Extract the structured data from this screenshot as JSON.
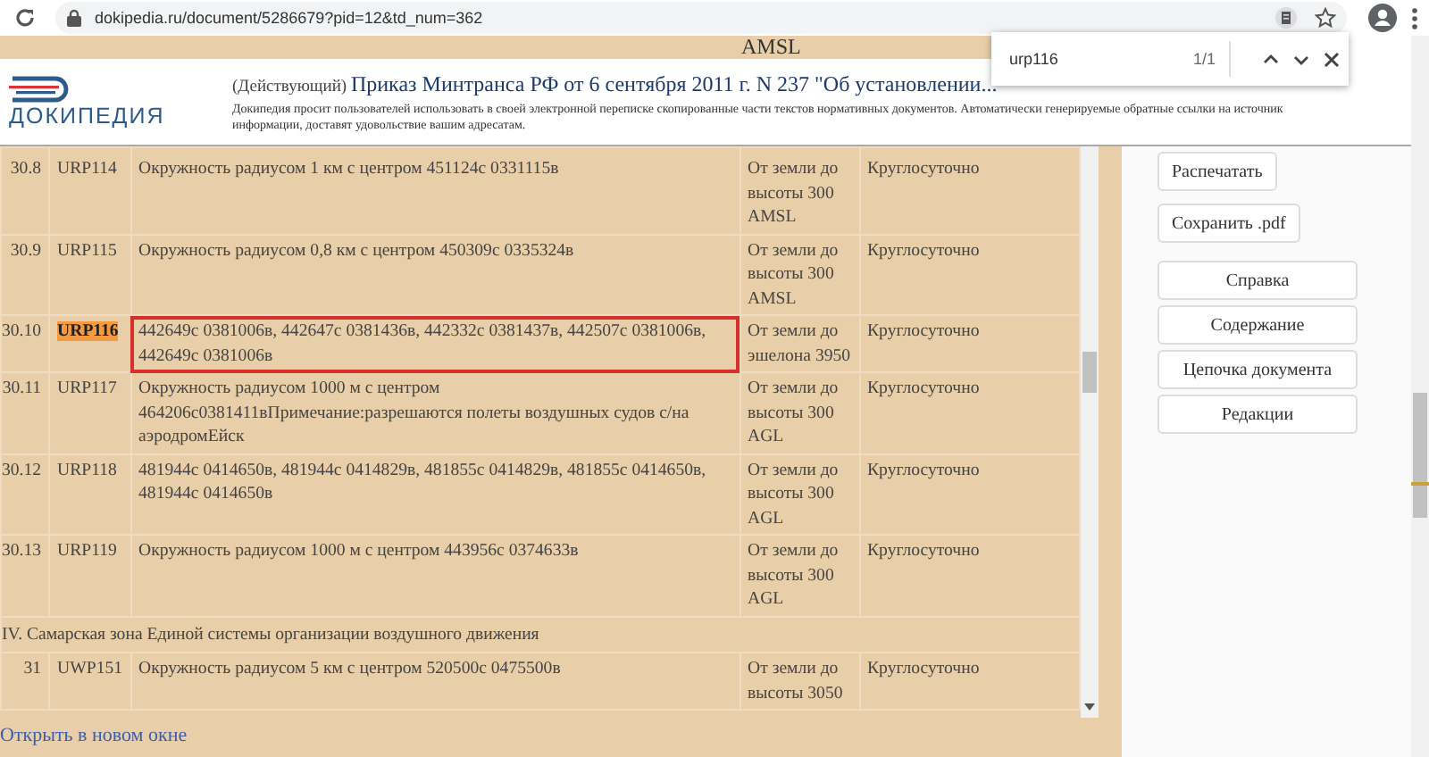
{
  "browser": {
    "url": "dokipedia.ru/document/5286679?pid=12&td_num=362",
    "find_bar": {
      "query": "urp116",
      "count": "1/1"
    }
  },
  "cut_row": {
    "altitude": "AMSL"
  },
  "header": {
    "logo_text": "ДОКИПЕДИЯ",
    "status": "(Действующий)",
    "title": "Приказ Минтранса РФ от 6 сентября 2011 г. N 237 \"Об установлении...",
    "notice": "Докипедия просит пользователей использовать в своей электронной переписке скопированные части текстов нормативных документов. Автоматически генерируемые обратные ссылки на источник информации, доставят удовольствие вашим адресатам."
  },
  "table": {
    "rows": [
      {
        "kind": "row",
        "number": "30.8",
        "code": "URP114",
        "description": "Окружность радиусом 1 км с центром 451124с 0331115в",
        "altitude": "От земли до высоты 300 AMSL",
        "schedule": "Круглосуточно",
        "search_match": false,
        "outlined": false
      },
      {
        "kind": "row",
        "number": "30.9",
        "code": "URP115",
        "description": "Окружность радиусом 0,8 км с центром 450309с 0335324в",
        "altitude": "От земли до высоты 300 AMSL",
        "schedule": "Круглосуточно",
        "search_match": false,
        "outlined": false
      },
      {
        "kind": "row",
        "number": "30.10",
        "code": "URP116",
        "description": "442649с 0381006в, 442647с 0381436в, 442332с 0381437в, 442507с 0381006в, 442649с 0381006в",
        "altitude": "От земли до эшелона 3950",
        "schedule": "Круглосуточно",
        "search_match": true,
        "outlined": true
      },
      {
        "kind": "row",
        "number": "30.11",
        "code": "URP117",
        "description": "Окружность радиусом 1000 м с центром 464206с0381411вПримечание:разрешаются полеты воздушных судов с/на аэродромЕйск",
        "altitude": "От земли до высоты 300 AGL",
        "schedule": "Круглосуточно",
        "search_match": false,
        "outlined": false
      },
      {
        "kind": "row",
        "number": "30.12",
        "code": "URP118",
        "description": "481944с 0414650в, 481944с 0414829в, 481855с 0414829в, 481855с 0414650в, 481944с 0414650в",
        "altitude": "От земли до высоты 300 AGL",
        "schedule": "Круглосуточно",
        "search_match": false,
        "outlined": false
      },
      {
        "kind": "row",
        "number": "30.13",
        "code": "URP119",
        "description": "Окружность радиусом 1000 м с центром 443956с 0374633в",
        "altitude": "От земли до высоты 300 AGL",
        "schedule": "Круглосуточно",
        "search_match": false,
        "outlined": false
      },
      {
        "kind": "section",
        "title": "IV. Самарская зона Единой системы организации воздушного движения"
      },
      {
        "kind": "row",
        "number": "31",
        "code": "UWP151",
        "description": "Окружность радиусом 5 км с центром 520500с 0475500в",
        "altitude": "От земли до высоты 3050",
        "schedule": "Круглосуточно",
        "search_match": false,
        "outlined": false
      }
    ]
  },
  "open_link": "Открыть в новом окне",
  "buttons": [
    {
      "label": "Распечатать",
      "kind": "small"
    },
    {
      "label": "Сохранить .pdf",
      "kind": "small"
    },
    {
      "label": "Справка",
      "kind": "wide"
    },
    {
      "label": "Содержание",
      "kind": "wide"
    },
    {
      "label": "Цепочка документа",
      "kind": "wide"
    },
    {
      "label": "Редакции",
      "kind": "wide"
    }
  ]
}
